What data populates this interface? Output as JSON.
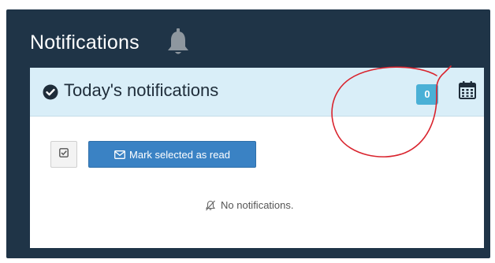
{
  "header": {
    "title": "Notifications",
    "icon": "bell-icon"
  },
  "card": {
    "title": "Today's notifications",
    "count": "0",
    "status_icon": "check-circle-icon",
    "calendar_icon": "calendar-icon"
  },
  "toolbar": {
    "select_icon": "check-square-icon",
    "mark_read_label": "Mark selected as read",
    "mark_read_icon": "envelope-icon"
  },
  "empty_state": {
    "text": "No notifications.",
    "icon": "bell-slash-icon"
  },
  "colors": {
    "panel_bg": "#1f3447",
    "card_header_bg": "#d9eef8",
    "badge_bg": "#4ab0d6",
    "primary_button": "#3a82c4",
    "annotation": "#d9232d"
  }
}
